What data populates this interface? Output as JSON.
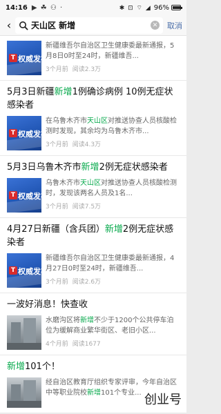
{
  "status": {
    "time": "14:16",
    "notif_icons": "▶ ☘ ⚇ ·",
    "sys_icons": "✱ ⊡ ⌔ ◢",
    "battery": "96%",
    "battery_level": 0.96
  },
  "search": {
    "query": "天山区  新增",
    "cancel_label": "取消",
    "back_glyph": "‹",
    "clear_glyph": "✕"
  },
  "results": [
    {
      "title_parts": [],
      "thumb": "权威发布",
      "snippet_parts": [
        "新疆维吾尔自治区卫生健康委最新通报，5月8日0时至24时，新疆维吾..."
      ],
      "time": "3个月前",
      "reads": "阅读2.3万"
    },
    {
      "title_parts": [
        "5月3日新疆",
        "新增",
        "1例确诊病例 10例无症状感染者"
      ],
      "thumb": "权威发布",
      "snippet_parts": [
        "在乌鲁木齐市",
        "天山区",
        "对推送协查人员核酸检测时发现，其余均为乌鲁木齐市..."
      ],
      "time": "3个月前",
      "reads": "阅读4.3万"
    },
    {
      "title_parts": [
        "5月3日乌鲁木齐市",
        "新增",
        "2例无症状感染者"
      ],
      "thumb": "权威发布",
      "snippet_parts": [
        "乌鲁木齐市",
        "天山区",
        "对推送协查人员核酸检测时，发现该两名人员及1名..."
      ],
      "time": "3个月前",
      "reads": "阅读7.5万"
    },
    {
      "title_parts": [
        "4月27日新疆（含兵团）",
        "新增",
        "2例无症状感染者"
      ],
      "thumb": "权威发布",
      "snippet_parts": [
        "新疆维吾尔自治区卫生健康委最新通报，4月27日0时至24时，新疆维吾..."
      ],
      "time": "3个月前",
      "reads": "阅读2.6万"
    },
    {
      "title_parts": [
        "一波好消息！快查收"
      ],
      "thumb": "",
      "snippet_parts": [
        "水磨沟区将",
        "新增",
        "不少于1200个公共停车泊位为缓解商业繁华街区、老旧小区..."
      ],
      "time": "4个月前",
      "reads": "阅读1677"
    },
    {
      "title_parts": [
        "",
        "新增",
        "101个！"
      ],
      "thumb": "",
      "snippet_parts": [
        "经自治区教育厅组织专家评审，今年自治区中等职业院校",
        "新增",
        "101个专业..."
      ],
      "time": "",
      "reads": ""
    }
  ],
  "watermark": "创业号"
}
